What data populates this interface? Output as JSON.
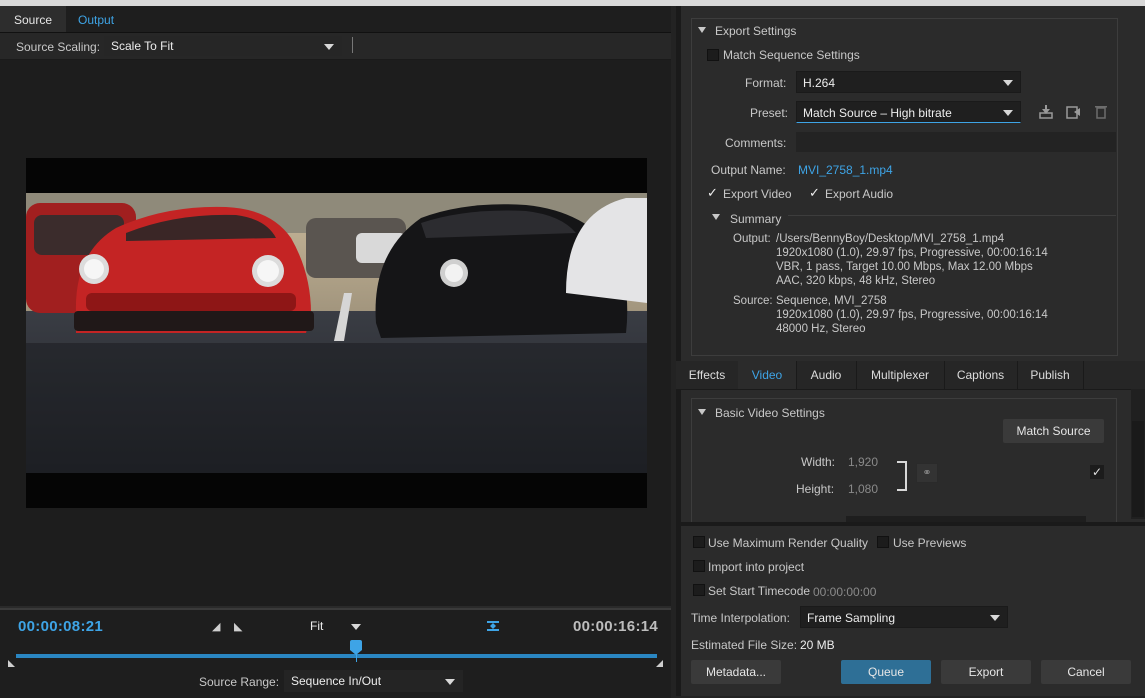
{
  "titlebar": {
    "text": "Export Settings"
  },
  "left_panel": {
    "tabs": [
      {
        "label": "Source"
      },
      {
        "label": "Output"
      }
    ],
    "source_scaling": {
      "label": "Source Scaling:",
      "value": "Scale To Fit"
    },
    "timeline": {
      "current_time": "00:00:08:21",
      "total_time": "00:00:16:14",
      "zoom": "Fit",
      "playhead_position": 0.53,
      "source_range_label": "Source Range:",
      "source_range_value": "Sequence In/Out"
    }
  },
  "export_settings": {
    "section_title": "Export Settings",
    "match_sequence": {
      "label": "Match Sequence Settings",
      "checked": false
    },
    "format": {
      "label": "Format:",
      "value": "H.264"
    },
    "preset": {
      "label": "Preset:",
      "value": "Match Source – High bitrate"
    },
    "comments": {
      "label": "Comments:",
      "value": ""
    },
    "output_name": {
      "label": "Output Name:",
      "value": "MVI_2758_1.mp4"
    },
    "export_video": {
      "label": "Export Video",
      "checked": true
    },
    "export_audio": {
      "label": "Export Audio",
      "checked": true
    },
    "summary": {
      "title": "Summary",
      "output_label": "Output:",
      "output_lines": [
        "/Users/BennyBoy/Desktop/MVI_2758_1.mp4",
        "1920x1080 (1.0), 29.97 fps, Progressive, 00:00:16:14",
        "VBR, 1 pass, Target 10.00 Mbps, Max 12.00 Mbps",
        "AAC, 320 kbps, 48 kHz, Stereo"
      ],
      "source_label": "Source:",
      "source_lines": [
        "Sequence, MVI_2758",
        "1920x1080 (1.0), 29.97 fps, Progressive, 00:00:16:14",
        "48000 Hz, Stereo"
      ]
    }
  },
  "tabs": [
    {
      "label": "Effects"
    },
    {
      "label": "Video",
      "active": true
    },
    {
      "label": "Audio"
    },
    {
      "label": "Multiplexer"
    },
    {
      "label": "Captions"
    },
    {
      "label": "Publish"
    }
  ],
  "video_settings": {
    "section_title": "Basic Video Settings",
    "match_source_button": "Match Source",
    "width_label": "Width:",
    "width_value": "1,920",
    "height_label": "Height:",
    "height_value": "1,080"
  },
  "bottom_options": {
    "max_render_quality": {
      "label": "Use Maximum Render Quality",
      "checked": false
    },
    "use_previews": {
      "label": "Use Previews",
      "checked": false
    },
    "import_into_project": {
      "label": "Import into project",
      "checked": false
    },
    "set_start_timecode": {
      "label": "Set Start Timecode",
      "value": "00:00:00:00",
      "checked": false
    },
    "time_interpolation": {
      "label": "Time Interpolation:",
      "value": "Frame Sampling"
    },
    "estimated_file_size": {
      "label": "Estimated File Size:",
      "value": "20 MB"
    }
  },
  "buttons": {
    "metadata": "Metadata...",
    "queue": "Queue",
    "export": "Export",
    "cancel": "Cancel"
  },
  "colors": {
    "accent": "#3ea4e6",
    "queue_button": "#2e6f96",
    "panel_bg": "#2b2b2b"
  }
}
